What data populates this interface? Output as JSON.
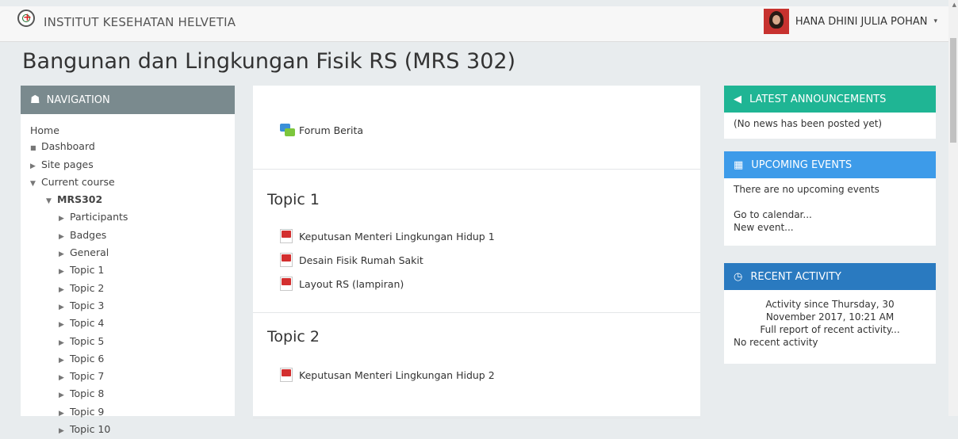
{
  "header": {
    "site_name": "INSTITUT KESEHATAN HELVETIA",
    "user_name": "HANA DHINI JULIA POHAN",
    "caret": "▾"
  },
  "page": {
    "title": "Bangunan dan Lingkungan Fisik RS (MRS 302)"
  },
  "navigation": {
    "header": "NAVIGATION",
    "items": [
      {
        "label": "Home"
      },
      {
        "label": "Dashboard"
      },
      {
        "label": "Site pages"
      },
      {
        "label": "Current course"
      },
      {
        "label": "MRS302"
      },
      {
        "label": "Participants"
      },
      {
        "label": "Badges"
      },
      {
        "label": "General"
      },
      {
        "label": "Topic 1"
      },
      {
        "label": "Topic 2"
      },
      {
        "label": "Topic 3"
      },
      {
        "label": "Topic 4"
      },
      {
        "label": "Topic 5"
      },
      {
        "label": "Topic 6"
      },
      {
        "label": "Topic 7"
      },
      {
        "label": "Topic 8"
      },
      {
        "label": "Topic 9"
      },
      {
        "label": "Topic 10"
      }
    ]
  },
  "main": {
    "forum": "Forum Berita",
    "sections": [
      {
        "title": "Topic 1",
        "resources": [
          "Keputusan Menteri Lingkungan Hidup 1",
          "Desain Fisik Rumah Sakit",
          "Layout RS (lampiran)"
        ]
      },
      {
        "title": "Topic 2",
        "resources": [
          "Keputusan Menteri Lingkungan Hidup 2"
        ]
      }
    ]
  },
  "blocks": {
    "announcements": {
      "header": "LATEST ANNOUNCEMENTS",
      "text": "(No news has been posted yet)",
      "color": "#1fb594"
    },
    "events": {
      "header": "UPCOMING EVENTS",
      "text": "There are no upcoming events",
      "link1": "Go to calendar...",
      "link2": "New event...",
      "color": "#3d9be9"
    },
    "activity": {
      "header": "RECENT ACTIVITY",
      "since": "Activity since Thursday, 30 November 2017, 10:21 AM",
      "full_report": "Full report of recent activity...",
      "none": "No recent activity",
      "color": "#2a7ac0"
    }
  }
}
